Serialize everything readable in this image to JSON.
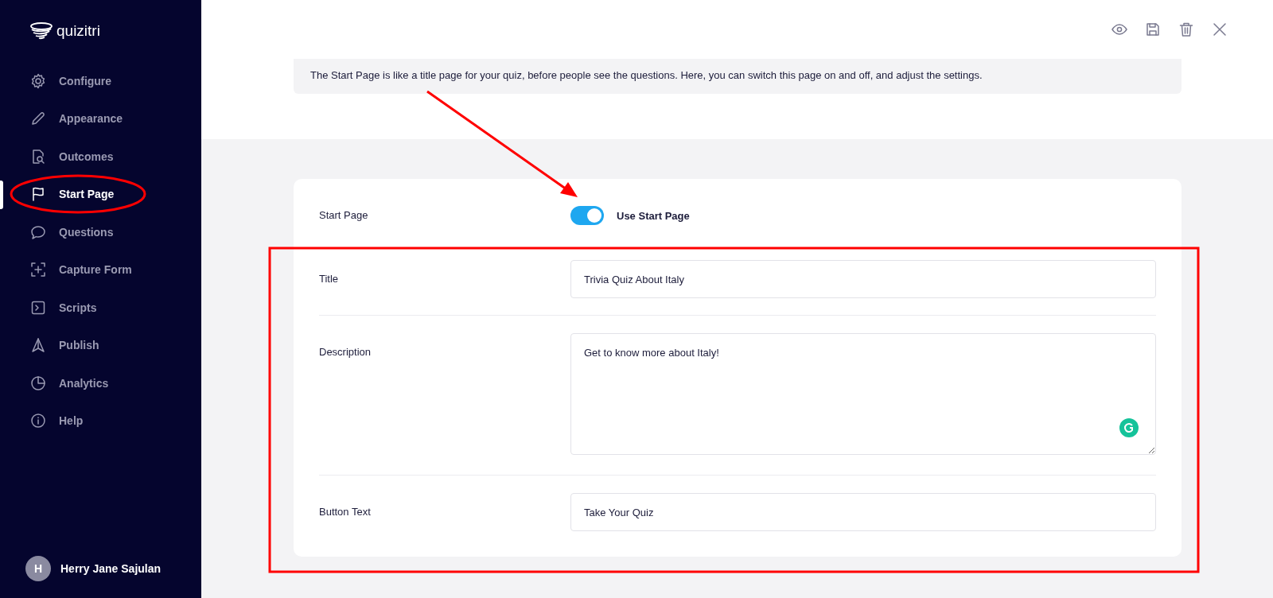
{
  "sidebar": {
    "logo": "quizitri",
    "items": [
      {
        "label": "Configure",
        "selected": false
      },
      {
        "label": "Appearance",
        "selected": false
      },
      {
        "label": "Outcomes",
        "selected": false
      },
      {
        "label": "Start Page",
        "selected": true
      },
      {
        "label": "Questions",
        "selected": false
      },
      {
        "label": "Capture Form",
        "selected": false
      },
      {
        "label": "Scripts",
        "selected": false
      },
      {
        "label": "Publish",
        "selected": false
      },
      {
        "label": "Analytics",
        "selected": false
      },
      {
        "label": "Help",
        "selected": false
      }
    ],
    "user": {
      "initial": "H",
      "name": "Herry Jane Sajulan"
    }
  },
  "info": "The Start Page is like a title page for your quiz, before people see the questions. Here, you can switch this page on and off, and adjust the settings.",
  "form": [
    {
      "kind": "toggle",
      "label": "Start Page",
      "on": true,
      "text": "Use Start Page"
    },
    {
      "kind": "text",
      "label": "Title",
      "value": "Trivia Quiz About Italy"
    },
    {
      "kind": "textarea",
      "label": "Description",
      "value": "Get to know more about Italy!"
    },
    {
      "kind": "text",
      "label": "Button Text",
      "value": "Take Your Quiz"
    }
  ],
  "annotations": [
    {
      "kind": "ellipse"
    },
    {
      "kind": "arrow"
    },
    {
      "kind": "rectangle"
    }
  ]
}
